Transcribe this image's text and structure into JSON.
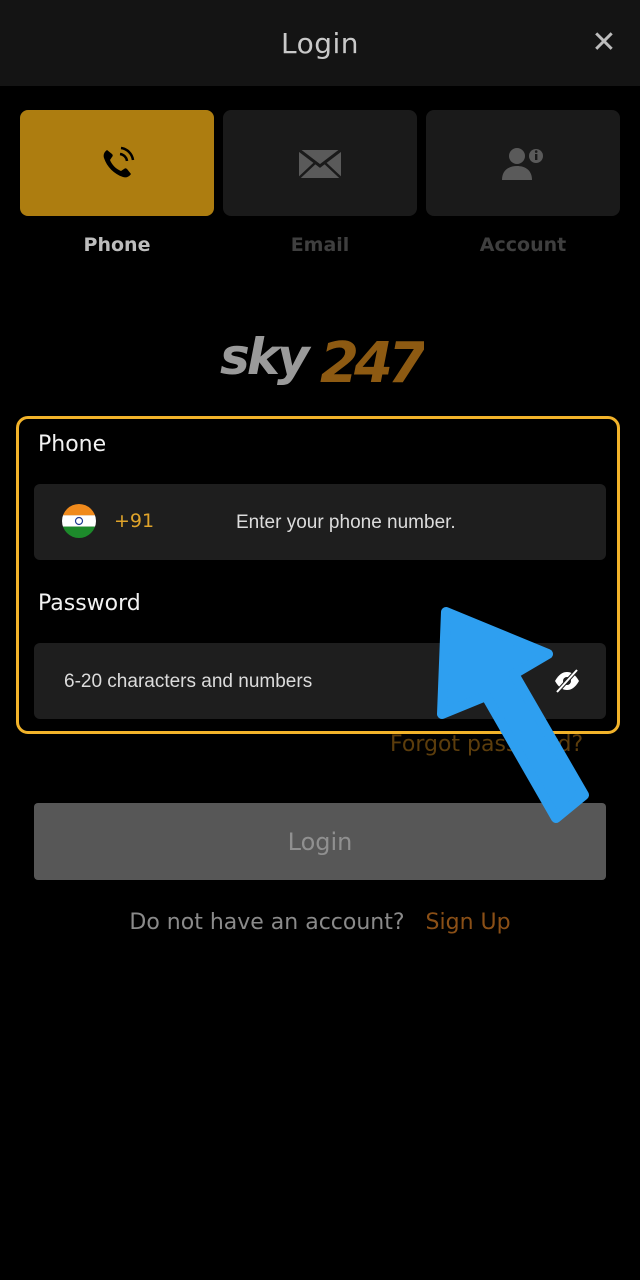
{
  "header": {
    "title": "Login",
    "close_icon": "close-icon"
  },
  "tabs": [
    {
      "label": "Phone",
      "icon": "phone-icon",
      "active": true
    },
    {
      "label": "Email",
      "icon": "mail-icon",
      "active": false
    },
    {
      "label": "Account",
      "icon": "user-info-icon",
      "active": false
    }
  ],
  "brand": {
    "logo_text_left": "sky",
    "logo_text_right": "247"
  },
  "form": {
    "phone_label": "Phone",
    "country_code": "+91",
    "phone_placeholder": "Enter your phone number.",
    "password_label": "Password",
    "password_placeholder": "6-20 characters and numbers",
    "eye_icon": "eye-off-icon"
  },
  "links": {
    "forgot_password": "Forgot password?"
  },
  "actions": {
    "login_label": "Login"
  },
  "footer": {
    "no_account_text": "Do not have an account?",
    "signup_label": "Sign Up"
  },
  "colors": {
    "accent": "#ad7d10",
    "highlight_border": "#f2b32a",
    "arrow": "#2e9ff0"
  }
}
